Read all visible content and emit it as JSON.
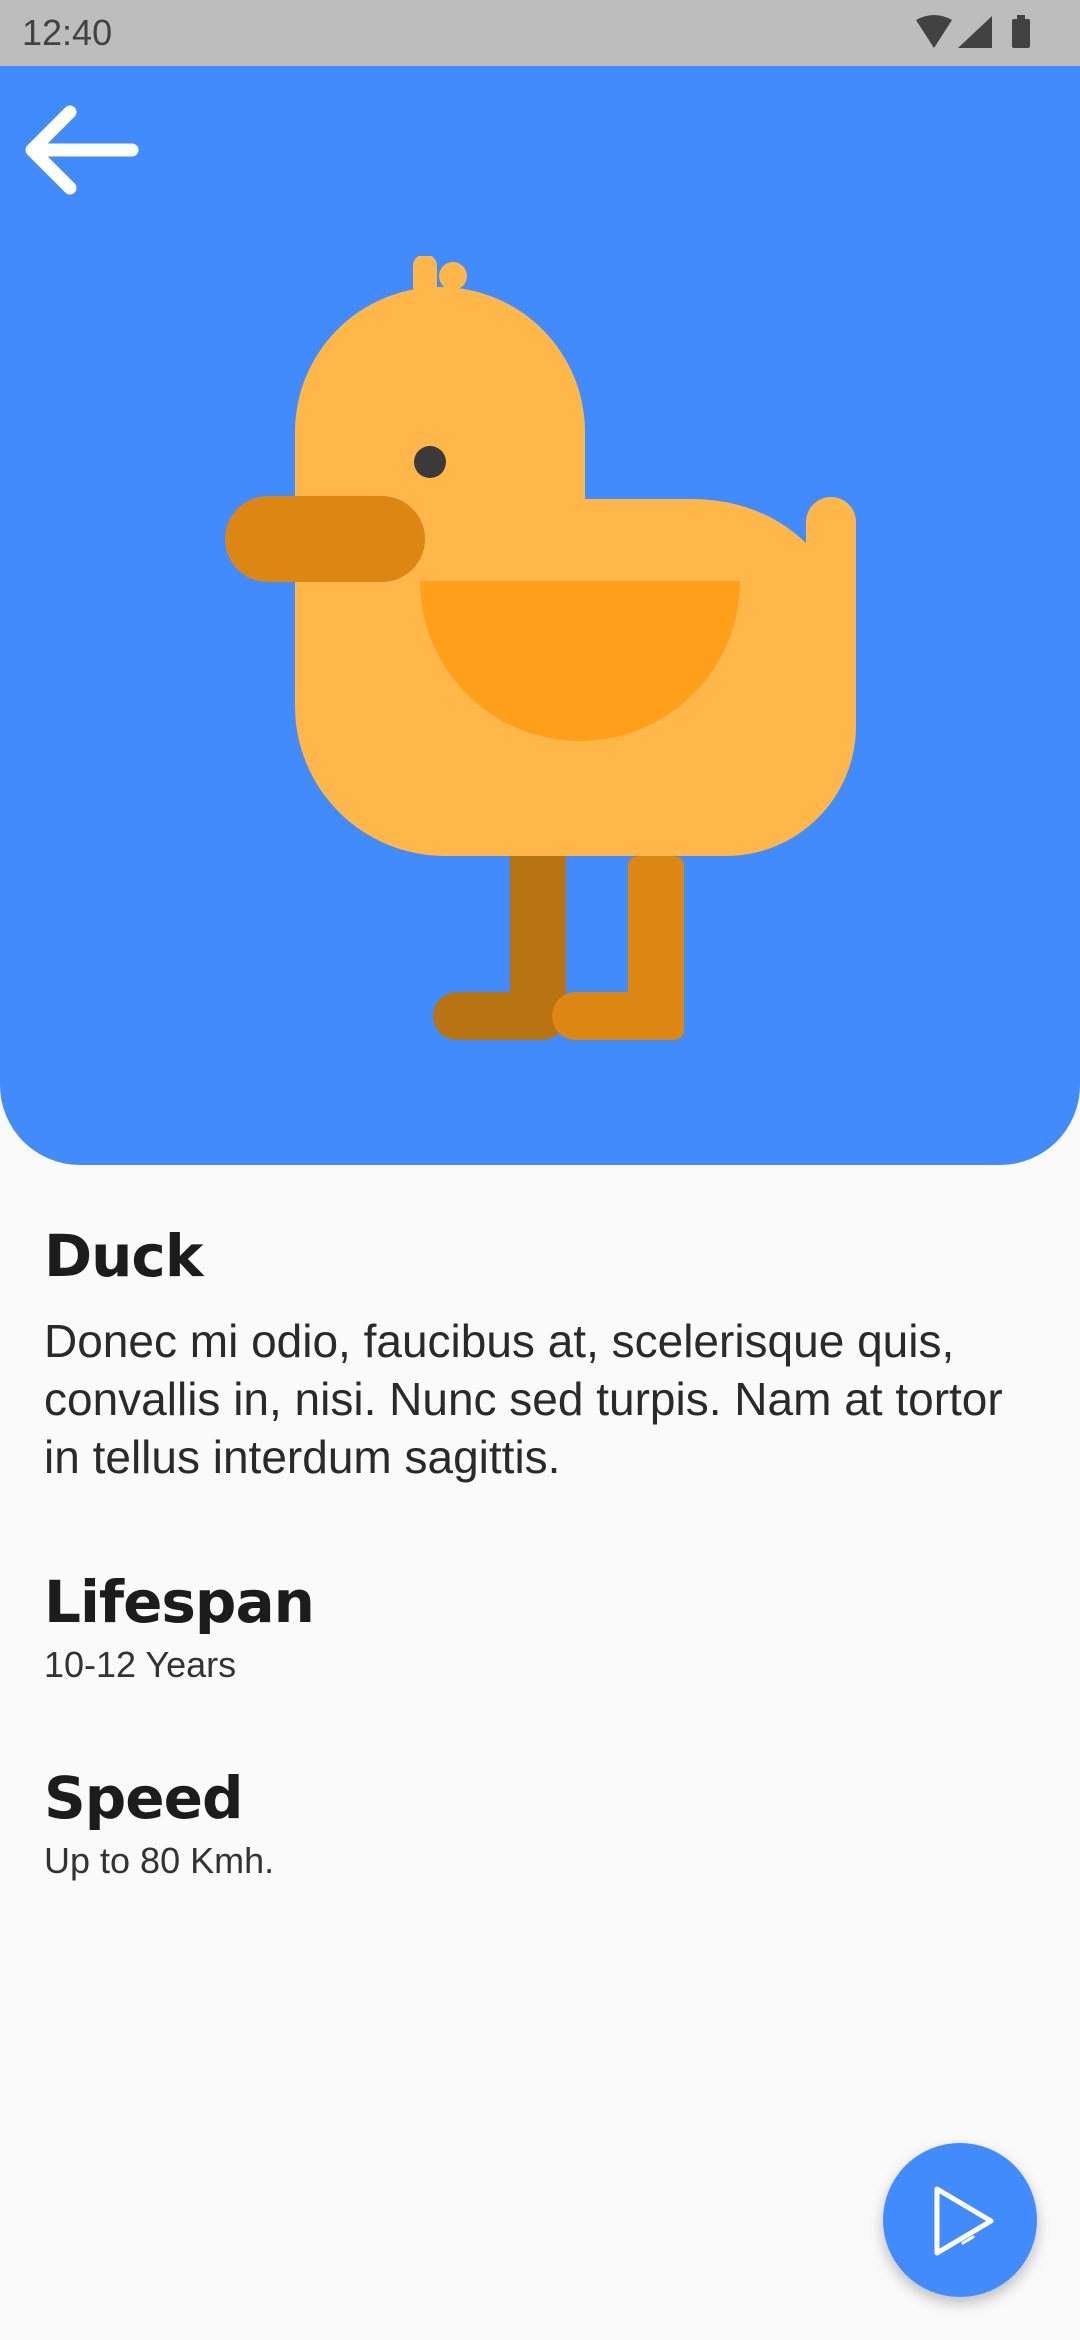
{
  "status_bar": {
    "time": "12:40",
    "icons": [
      "wifi-icon",
      "signal-icon",
      "battery-icon"
    ]
  },
  "hero": {
    "background_color": "#428bfc",
    "back_icon": "arrow-left-icon",
    "illustration": "duck-illustration"
  },
  "animal": {
    "name": "Duck",
    "description": "Donec mi odio, faucibus at, scelerisque quis, convallis in, nisi. Nunc sed turpis. Nam at tortor in tellus interdum sagittis."
  },
  "lifespan": {
    "title": "Lifespan",
    "value": "10-12 Years"
  },
  "speed": {
    "title": "Speed",
    "value": "Up to 80 Kmh."
  },
  "fab": {
    "icon": "play-icon",
    "color": "#428bfc"
  }
}
